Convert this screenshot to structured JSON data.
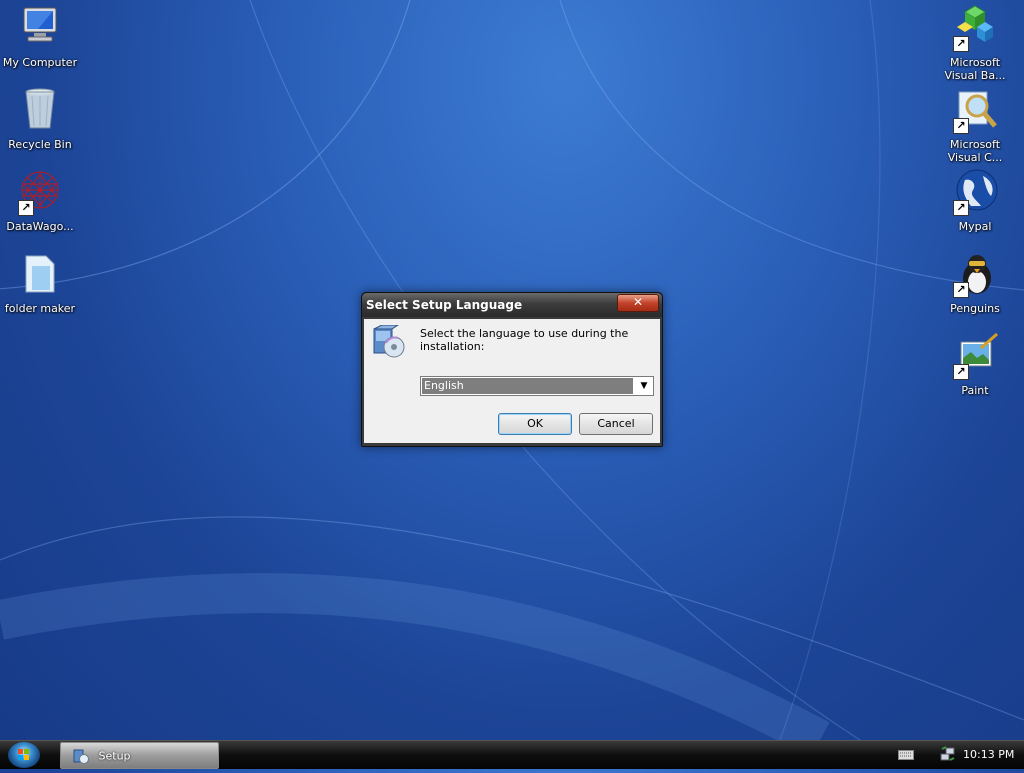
{
  "desktop": {
    "left_icons": [
      {
        "label": "My Computer"
      },
      {
        "label": "Recycle Bin"
      },
      {
        "label": "DataWago..."
      },
      {
        "label": "folder maker"
      }
    ],
    "right_icons": [
      {
        "label": "Microsoft Visual Ba..."
      },
      {
        "label": "Microsoft Visual C..."
      },
      {
        "label": "Mypal"
      },
      {
        "label": "Penguins"
      },
      {
        "label": "Paint"
      }
    ]
  },
  "dialog": {
    "title": "Select Setup Language",
    "close_symbol": "✕",
    "prompt": "Select the language to use during the installation:",
    "language_selected": "English",
    "dropdown_symbol": "▼",
    "ok_label": "OK",
    "cancel_label": "Cancel"
  },
  "taskbar": {
    "task_label": "Setup",
    "clock": "10:13 PM"
  },
  "colors": {
    "desktop_blue": "#2a5fb8",
    "titlebar": "#3c3c3c",
    "close_red": "#c4422a"
  }
}
